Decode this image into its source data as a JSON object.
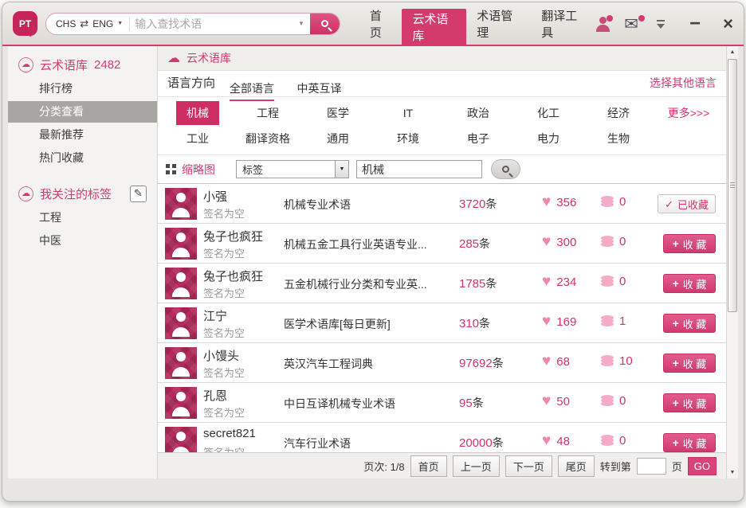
{
  "colors": {
    "accent": "#d23b6d",
    "accent_deep": "#c5265a",
    "heart": "#ef86ae",
    "selected_item_bg": "#a8a6a3"
  },
  "titlebar": {
    "logo_text": "PT",
    "search": {
      "lang_from": "CHS",
      "lang_to": "ENG",
      "placeholder": "输入查找术语"
    },
    "nav": [
      {
        "label": "首页"
      },
      {
        "label": "云术语库",
        "active": true
      },
      {
        "label": "术语管理"
      },
      {
        "label": "翻译工具"
      }
    ],
    "minimize_glyph": "−",
    "close_glyph": "×"
  },
  "sidebar": {
    "library": {
      "title": "云术语库",
      "count": "2482",
      "items": [
        {
          "label": "排行榜"
        },
        {
          "label": "分类查看",
          "selected": true
        },
        {
          "label": "最新推荐"
        },
        {
          "label": "热门收藏"
        }
      ]
    },
    "tags": {
      "title": "我关注的标签",
      "items": [
        {
          "label": "工程"
        },
        {
          "label": "中医"
        }
      ]
    }
  },
  "main": {
    "header_title": "云术语库",
    "language": {
      "label": "语言方向",
      "tabs": [
        {
          "label": "全部语言",
          "active": true
        },
        {
          "label": "中英互译"
        }
      ],
      "other_link": "选择其他语言"
    },
    "categories": {
      "row1": [
        {
          "label": "机械",
          "selected": true
        },
        {
          "label": "工程"
        },
        {
          "label": "医学"
        },
        {
          "label": "IT"
        },
        {
          "label": "政治"
        },
        {
          "label": "化工"
        },
        {
          "label": "经济"
        }
      ],
      "more": "更多>>>",
      "row2": [
        {
          "label": "工业"
        },
        {
          "label": "翻译资格"
        },
        {
          "label": "通用"
        },
        {
          "label": "环境"
        },
        {
          "label": "电子"
        },
        {
          "label": "电力"
        },
        {
          "label": "生物"
        }
      ]
    },
    "toolbar": {
      "view_label": "缩略图",
      "filter_value": "标签",
      "search_value": "机械"
    },
    "rows": [
      {
        "name": "小强",
        "sig": "签名为空",
        "desc": "机械专业术语",
        "count": "3720",
        "unit": "条",
        "likes": "356",
        "comments": "0",
        "action": "已收藏",
        "collected": true
      },
      {
        "name": "兔子也疯狂",
        "sig": "签名为空",
        "desc": "机械五金工具行业英语专业...",
        "count": "285",
        "unit": "条",
        "likes": "300",
        "comments": "0",
        "action": "收 藏"
      },
      {
        "name": "兔子也疯狂",
        "sig": "签名为空",
        "desc": "五金机械行业分类和专业英...",
        "count": "1785",
        "unit": "条",
        "likes": "234",
        "comments": "0",
        "action": "收 藏"
      },
      {
        "name": "江宁",
        "sig": "签名为空",
        "desc": "医学术语库[每日更新]",
        "count": "310",
        "unit": "条",
        "likes": "169",
        "comments": "1",
        "action": "收 藏"
      },
      {
        "name": "小馒头",
        "sig": "签名为空",
        "desc": "英汉汽车工程词典",
        "count": "97692",
        "unit": "条",
        "likes": "68",
        "comments": "10",
        "action": "收 藏"
      },
      {
        "name": "孔恩",
        "sig": "签名为空",
        "desc": "中日互译机械专业术语",
        "count": "95",
        "unit": "条",
        "likes": "50",
        "comments": "0",
        "action": "收 藏"
      },
      {
        "name": "secret821",
        "sig": "签名为空",
        "desc": "汽车行业术语",
        "count": "20000",
        "unit": "条",
        "likes": "48",
        "comments": "0",
        "action": "收 藏"
      }
    ],
    "pagination": {
      "page_label": "页次:",
      "page_value": "1/8",
      "first": "首页",
      "prev": "上一页",
      "next": "下一页",
      "last": "尾页",
      "goto_prefix": "转到第",
      "goto_suffix": "页",
      "go": "GO"
    }
  }
}
